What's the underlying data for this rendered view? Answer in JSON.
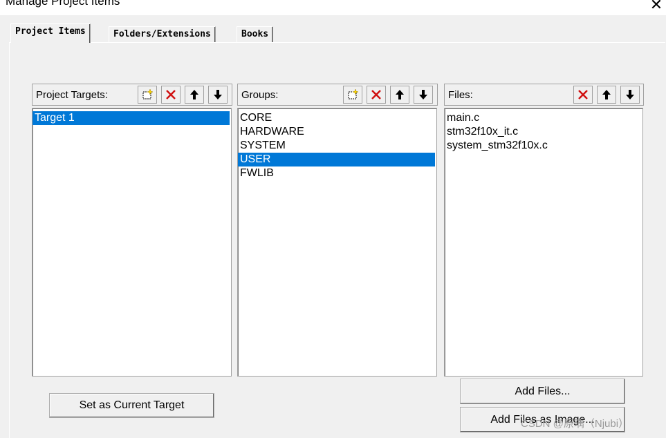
{
  "window": {
    "title": "Manage Project Items",
    "close_glyph": "✕"
  },
  "tabs": [
    {
      "label": "Project Items",
      "active": true
    },
    {
      "label": "Folders/Extensions",
      "active": false
    },
    {
      "label": "Books",
      "active": false
    }
  ],
  "targets": {
    "label": "Project Targets:",
    "items": [
      "Target 1"
    ],
    "selected": 0
  },
  "groups": {
    "label": "Groups:",
    "items": [
      "CORE",
      "HARDWARE",
      "SYSTEM",
      "USER",
      "FWLIB"
    ],
    "selected": 3
  },
  "files": {
    "label": "Files:",
    "items": [
      "main.c",
      "stm32f10x_it.c",
      "system_stm32f10x.c"
    ]
  },
  "buttons": {
    "set_current_target": "Set as Current Target",
    "add_files": "Add Files...",
    "add_files_as_image": "Add Files as Image..."
  },
  "watermark": "CSDN @原瑀（Njubi）",
  "icons": {
    "new": "new-item-icon",
    "delete": "delete-icon",
    "up": "move-up-icon",
    "down": "move-down-icon"
  },
  "colors": {
    "selection": "#0078d7",
    "delete_red": "#d01010"
  }
}
